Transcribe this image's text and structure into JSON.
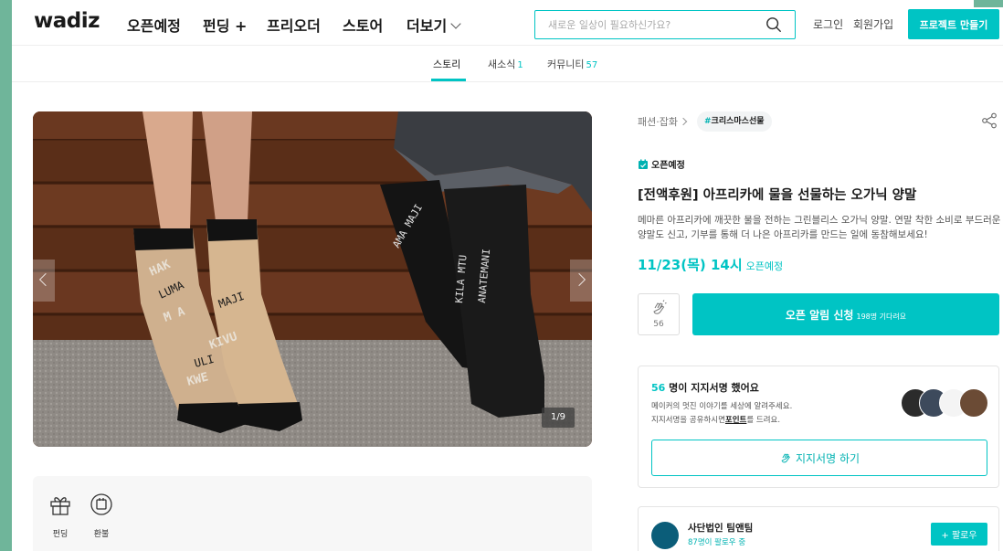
{
  "header": {
    "logo": "wadiz",
    "nav": [
      "오픈예정",
      "펀딩 +",
      "프리오더",
      "스토어",
      "더보기"
    ],
    "search_placeholder": "새로운 일상이 필요하신가요?",
    "login": "로그인",
    "signup": "회원가입",
    "make_project": "프로젝트 만들기"
  },
  "tabs": [
    {
      "label": "스토리",
      "count": ""
    },
    {
      "label": "새소식",
      "count": "1"
    },
    {
      "label": "커뮤니티",
      "count": "57"
    }
  ],
  "gallery": {
    "counter": "1/9"
  },
  "benefits": [
    {
      "icon": "gift-icon",
      "label": "펀딩"
    },
    {
      "icon": "refund-icon",
      "label": "환불"
    }
  ],
  "project": {
    "category": "패션·잡화",
    "hashtag_symbol": "#",
    "hashtag": "크리스마스선물",
    "status": "오픈예정",
    "title": "[전액후원] 아프리카에 물을 선물하는 오가닉 양말",
    "description": "메마른 아프리카에 깨끗한 물을 전하는 그린블리스 오가닉 양말. 연말 착한 소비로 부드러운 양말도 신고, 기부를 통해 더 나은 아프리카를 만드는 일에 동참해보세요!",
    "open_date": "11/23(목) 14시",
    "open_date_suffix": "오픈예정",
    "clap_count": "56",
    "notify_label": "오픈 알림 신청",
    "notify_waiting": "198명 기다려요"
  },
  "support": {
    "count": "56",
    "title_suffix": "명이 지지서명 했어요",
    "desc_line1": "메이커의 멋진 이야기를 세상에 알려주세요.",
    "desc_line2_prefix": "지지서명을 공유하시면",
    "desc_line2_bold": "포인트",
    "desc_line2_suffix": "를 드려요.",
    "sign_button": "지지서명 하기"
  },
  "maker": {
    "name": "사단법인 팀앤팀",
    "followers": "87명이 팔로우 중",
    "follow_button": "+ 팔로우"
  },
  "colors": {
    "accent": "#00c4c4",
    "frame_bg": "#6fb59a"
  }
}
